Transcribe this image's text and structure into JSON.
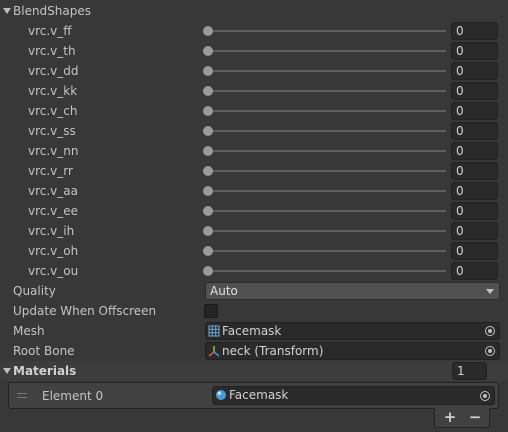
{
  "blendshapes": {
    "title": "BlendShapes",
    "items": [
      {
        "label": "vrc.v_ff",
        "value": "0"
      },
      {
        "label": "vrc.v_th",
        "value": "0"
      },
      {
        "label": "vrc.v_dd",
        "value": "0"
      },
      {
        "label": "vrc.v_kk",
        "value": "0"
      },
      {
        "label": "vrc.v_ch",
        "value": "0"
      },
      {
        "label": "vrc.v_ss",
        "value": "0"
      },
      {
        "label": "vrc.v_nn",
        "value": "0"
      },
      {
        "label": "vrc.v_rr",
        "value": "0"
      },
      {
        "label": "vrc.v_aa",
        "value": "0"
      },
      {
        "label": "vrc.v_ee",
        "value": "0"
      },
      {
        "label": "vrc.v_ih",
        "value": "0"
      },
      {
        "label": "vrc.v_oh",
        "value": "0"
      },
      {
        "label": "vrc.v_ou",
        "value": "0"
      }
    ]
  },
  "quality": {
    "label": "Quality",
    "value": "Auto"
  },
  "update_offscreen": {
    "label": "Update When Offscreen",
    "checked": false
  },
  "mesh": {
    "label": "Mesh",
    "value": "Facemask",
    "icon": "mesh-icon"
  },
  "root_bone": {
    "label": "Root Bone",
    "value": "neck (Transform)",
    "icon": "transform-icon"
  },
  "materials": {
    "title": "Materials",
    "count": "1",
    "elements": [
      {
        "label": "Element 0",
        "value": "Facemask",
        "icon": "material-icon"
      }
    ],
    "add_label": "+",
    "remove_label": "−"
  },
  "colors": {
    "background": "#383838",
    "field": "#2a2a2a",
    "text": "#c4c4c4",
    "slider_thumb": "#999999",
    "material_icon": "#4a9ad8"
  }
}
